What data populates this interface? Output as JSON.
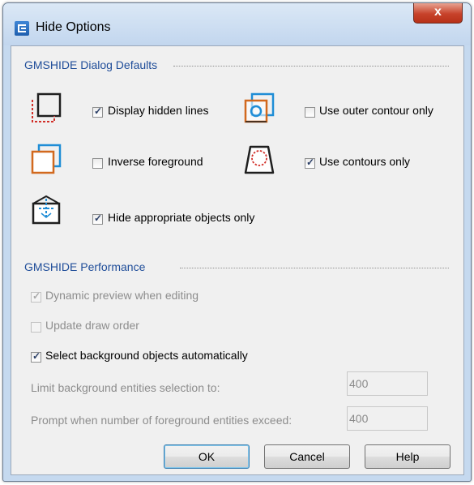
{
  "window": {
    "title": "Hide Options",
    "close_label": "x"
  },
  "defaults_group": {
    "title": "GMSHIDE Dialog Defaults",
    "display_hidden_lines": {
      "label": "Display hidden lines",
      "checked": true
    },
    "use_outer_contour_only": {
      "label": "Use outer contour only",
      "checked": false
    },
    "inverse_foreground": {
      "label": "Inverse foreground",
      "checked": false
    },
    "use_contours_only": {
      "label": "Use contours only",
      "checked": true
    },
    "hide_appropriate_objects_only": {
      "label": "Hide appropriate objects only",
      "checked": true
    }
  },
  "performance_group": {
    "title": "GMSHIDE Performance",
    "dynamic_preview": {
      "label": "Dynamic preview when editing",
      "checked": true,
      "enabled": false
    },
    "update_draw_order": {
      "label": "Update draw order",
      "checked": false,
      "enabled": false
    },
    "select_background": {
      "label": "Select background objects automatically",
      "checked": true,
      "enabled": true
    },
    "limit_background_label": "Limit background entities selection to:",
    "limit_background_value": "400",
    "prompt_foreground_label": "Prompt when number of foreground entities exceed:",
    "prompt_foreground_value": "400"
  },
  "buttons": {
    "ok": "OK",
    "cancel": "Cancel",
    "help": "Help"
  },
  "colors": {
    "accent_blue": "#1f8dd6",
    "accent_orange": "#d2691e",
    "group_title": "#1f4d99"
  }
}
